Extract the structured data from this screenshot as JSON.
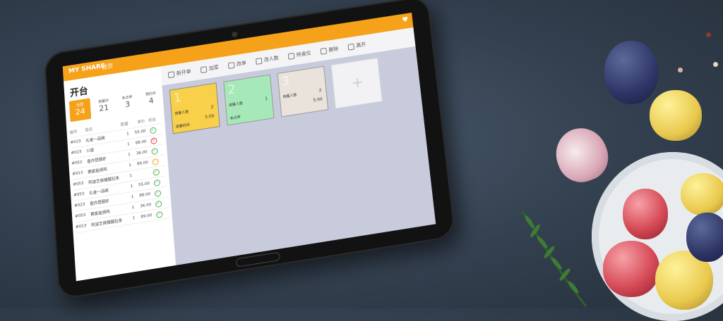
{
  "app": {
    "brand": "MY SHARE",
    "brand_sub": "首页",
    "section_title": "开台"
  },
  "toolbar": [
    {
      "label": "新开单",
      "icon": "edit-icon"
    },
    {
      "label": "加菜",
      "icon": "list-icon"
    },
    {
      "label": "改单",
      "icon": "layers-icon"
    },
    {
      "label": "改人数",
      "icon": "user-icon"
    },
    {
      "label": "转桌位",
      "icon": "refresh-icon"
    },
    {
      "label": "删除",
      "icon": "close-icon"
    },
    {
      "label": "离开",
      "icon": "exit-icon"
    }
  ],
  "stats": [
    {
      "label": "全部",
      "value": "24"
    },
    {
      "label": "用餐中",
      "value": "21"
    },
    {
      "label": "未点单",
      "value": "3"
    },
    {
      "label": "预约中",
      "value": "4"
    }
  ],
  "table": {
    "headers": [
      "编号",
      "菜名",
      "数量",
      "单价",
      "状态"
    ],
    "rows": [
      {
        "id": "#023",
        "name": "孔雀一品碗",
        "qty": "1",
        "price": "55.00",
        "status": "ok"
      },
      {
        "id": "#023",
        "name": "川菜",
        "qty": "1",
        "price": "88.00",
        "status": "x"
      },
      {
        "id": "#052",
        "name": "香炸琵琶虾",
        "qty": "1",
        "price": "36.00",
        "status": "ok"
      },
      {
        "id": "#013",
        "name": "赛家盐焗鸡",
        "qty": "1",
        "price": "89.00",
        "status": "m"
      },
      {
        "id": "#053",
        "name": "阿波芝麻猪腿拉条",
        "qty": "1",
        "price": "",
        "status": "ok"
      },
      {
        "id": "#053",
        "name": "孔雀一品碗",
        "qty": "1",
        "price": "55.00",
        "status": "ok"
      },
      {
        "id": "#023",
        "name": "香炸琵琶虾",
        "qty": "1",
        "price": "88.00",
        "status": "ok"
      },
      {
        "id": "#053",
        "name": "赛家盐焗鸡",
        "qty": "1",
        "price": "36.00",
        "status": "ok"
      },
      {
        "id": "#013",
        "name": "阿波芝麻猪腿拉条",
        "qty": "1",
        "price": "89.00",
        "status": "ok"
      }
    ]
  },
  "cards": [
    {
      "num": "1",
      "count": "2",
      "people": "用餐人数",
      "time": "5:00",
      "status": "用餐时间",
      "color": "#f9d04a"
    },
    {
      "num": "2",
      "count": "1",
      "people": "用餐人数",
      "time": "",
      "status": "未点单",
      "color": "#a7e8b8"
    },
    {
      "num": "3",
      "count": "2",
      "people": "用餐人数",
      "time": "5:00",
      "status": "",
      "color": "#e9e3dc"
    }
  ],
  "add_card": "+"
}
